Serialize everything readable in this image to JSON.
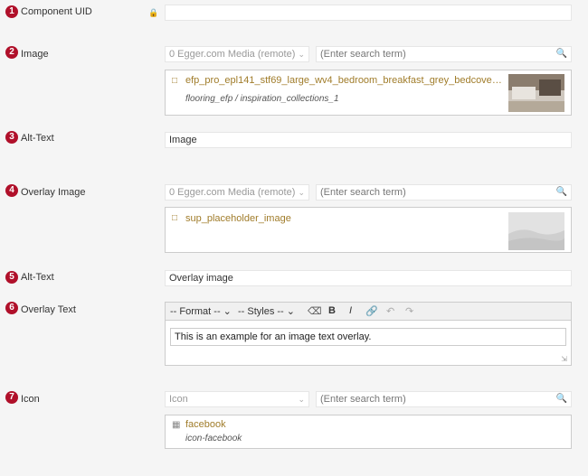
{
  "fields": [
    {
      "num": "1",
      "label": "Component UID"
    },
    {
      "num": "2",
      "label": "Image"
    },
    {
      "num": "3",
      "label": "Alt-Text"
    },
    {
      "num": "4",
      "label": "Overlay Image"
    },
    {
      "num": "5",
      "label": "Alt-Text"
    },
    {
      "num": "6",
      "label": "Overlay Text"
    },
    {
      "num": "7",
      "label": "Icon"
    }
  ],
  "component_uid": {
    "value": "",
    "lock_icon": "lock-icon"
  },
  "image": {
    "source": "0 Egger.com Media (remote)",
    "search_placeholder": "(Enter search term)",
    "asset_title": "efp_pro_epl141_stf69_large_wv4_bedroom_breakfast_grey_bedcover_la...",
    "asset_path": "flooring_efp / inspiration_collections_1"
  },
  "alt_text_1": {
    "value": "Image"
  },
  "overlay_image": {
    "source": "0 Egger.com Media (remote)",
    "search_placeholder": "(Enter search term)",
    "asset_title": "sup_placeholder_image"
  },
  "alt_text_2": {
    "value": "Overlay image"
  },
  "overlay_text": {
    "format_label": "-- Format --",
    "styles_label": "-- Styles --",
    "bold": "B",
    "italic": "I",
    "content": "This is an example for an image text overlay."
  },
  "icon_field": {
    "source": "Icon",
    "search_placeholder": "(Enter search term)",
    "asset_title": "facebook",
    "asset_sub": "icon-facebook"
  },
  "colors": {
    "badge": "#b0102a",
    "asset_link": "#a07c2a"
  }
}
